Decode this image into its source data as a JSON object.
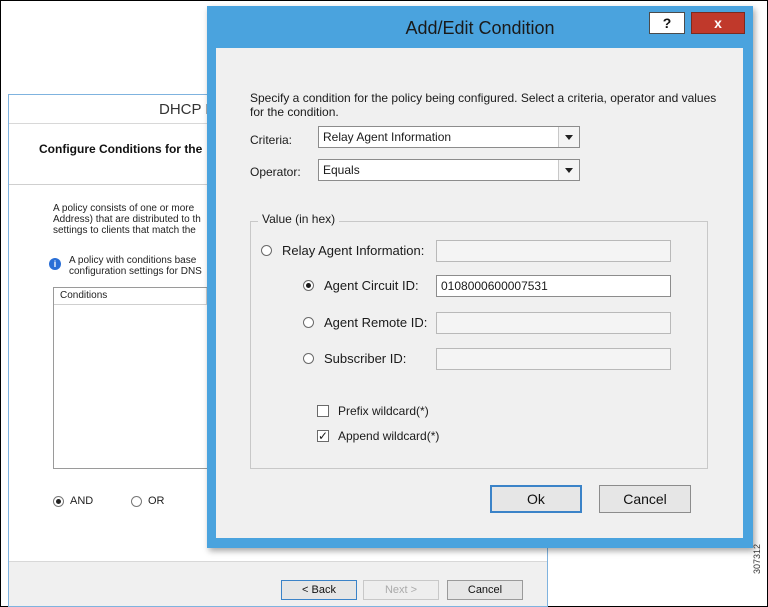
{
  "background_window": {
    "title": "DHCP P",
    "header": "Configure Conditions for the",
    "description": "A policy consists of one or more Address) that are distributed to th settings to clients that match the",
    "info_text": "A policy with conditions base configuration settings for DNS",
    "conditions_header": "Conditions",
    "and_label": "AND",
    "or_label": "OR",
    "back_label": "< Back",
    "next_label": "Next >",
    "cancel_label": "Cancel"
  },
  "dialog": {
    "title": "Add/Edit Condition",
    "help_glyph": "?",
    "close_glyph": "x",
    "intro": "Specify a condition for the policy being configured. Select a criteria, operator and values for the condition.",
    "criteria_label": "Criteria:",
    "criteria_value": "Relay Agent Information",
    "operator_label": "Operator:",
    "operator_value": "Equals",
    "value_group_label": "Value (in hex)",
    "relay_agent_label": "Relay Agent Information:",
    "relay_agent_value": "",
    "agent_circuit_label": "Agent Circuit ID:",
    "agent_circuit_value": "0108000600007531",
    "agent_remote_label": "Agent Remote ID:",
    "agent_remote_value": "",
    "subscriber_label": "Subscriber ID:",
    "subscriber_value": "",
    "prefix_wildcard_label": "Prefix wildcard(*)",
    "prefix_wildcard_checked": false,
    "append_wildcard_label": "Append wildcard(*)",
    "append_wildcard_checked": true,
    "ok_label": "Ok",
    "cancel_label": "Cancel"
  },
  "figure_number": "307312",
  "colors": {
    "dialog_frame": "#4aa3de",
    "close_button": "#c0392b",
    "client_bg": "#f0f0f0"
  }
}
